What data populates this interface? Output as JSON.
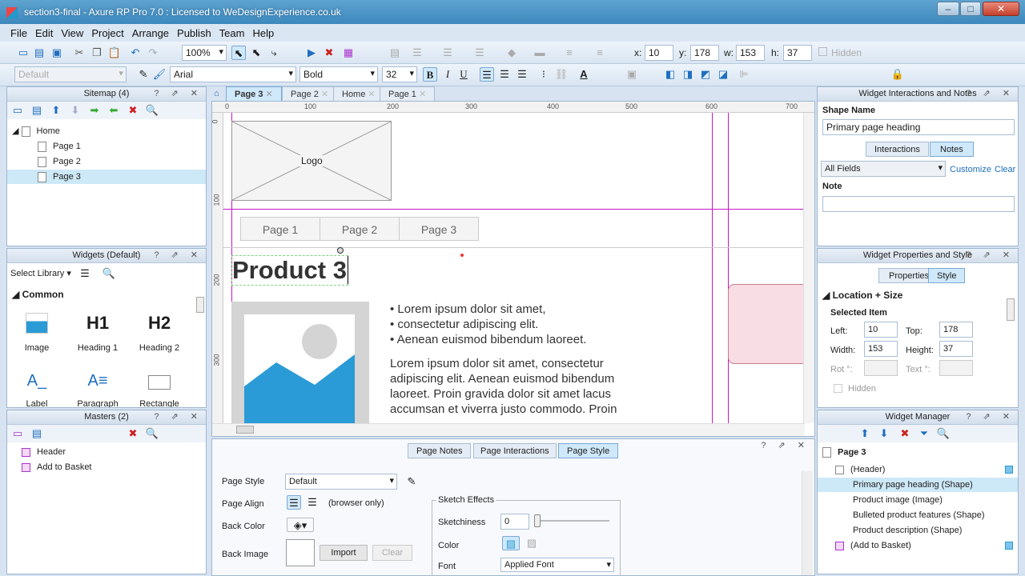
{
  "window": {
    "title": "section3-final - Axure RP Pro 7.0 : Licensed to WeDesignExperience.co.uk"
  },
  "menu": [
    "File",
    "Edit",
    "View",
    "Project",
    "Arrange",
    "Publish",
    "Team",
    "Help"
  ],
  "toolbar": {
    "zoom": "100%",
    "x_label": "x:",
    "x": "10",
    "y_label": "y:",
    "y": "178",
    "w_label": "w:",
    "w": "153",
    "h_label": "h:",
    "h": "37",
    "hidden": "Hidden"
  },
  "format": {
    "style": "Default",
    "font": "Arial",
    "weight": "Bold",
    "size": "32"
  },
  "sitemap": {
    "title": "Sitemap (4)",
    "items": [
      "Home",
      "Page 1",
      "Page 2",
      "Page 3"
    ]
  },
  "widgets": {
    "title": "Widgets (Default)",
    "select_library": "Select Library",
    "section": "Common",
    "items": [
      {
        "label": "Image",
        "glyph": ""
      },
      {
        "label": "Heading 1",
        "glyph": "H1"
      },
      {
        "label": "Heading 2",
        "glyph": "H2"
      },
      {
        "label": "Label",
        "glyph": "A_"
      },
      {
        "label": "Paragraph",
        "glyph": "A≡"
      },
      {
        "label": "Rectangle",
        "glyph": ""
      }
    ]
  },
  "masters": {
    "title": "Masters (2)",
    "items": [
      "Header",
      "Add to Basket"
    ]
  },
  "tabs": [
    "Page 3",
    "Page 2",
    "Home",
    "Page 1"
  ],
  "ruler": {
    "h": [
      "0",
      "100",
      "200",
      "300",
      "400",
      "500",
      "600",
      "700"
    ],
    "v": [
      "0",
      "100",
      "200",
      "300"
    ]
  },
  "canvas": {
    "logo": "Logo",
    "nav": [
      "Page 1",
      "Page 2",
      "Page 3"
    ],
    "heading": "Product 3",
    "bullets": [
      "• Lorem ipsum dolor sit amet,",
      "• consectetur adipiscing elit.",
      "• Aenean euismod bibendum laoreet."
    ],
    "para": [
      "Lorem ipsum dolor sit amet, consectetur",
      "adipiscing elit. Aenean euismod bibendum",
      "laoreet. Proin gravida dolor sit amet lacus",
      "accumsan et viverra justo commodo. Proin"
    ]
  },
  "pagepanel": {
    "tabs": [
      "Page Notes",
      "Page Interactions",
      "Page Style"
    ],
    "page_style_label": "Page Style",
    "page_style": "Default",
    "page_align_label": "Page Align",
    "browser_only": "(browser only)",
    "back_color": "Back Color",
    "back_image": "Back Image",
    "import": "Import",
    "clear": "Clear",
    "sketch_title": "Sketch Effects",
    "sketchiness": "Sketchiness",
    "sketch_value": "0",
    "color": "Color",
    "font": "Font",
    "font_value": "Applied Font"
  },
  "interactions": {
    "title": "Widget Interactions and Notes",
    "shape_name_label": "Shape Name",
    "shape_name": "Primary page heading",
    "tabs": [
      "Interactions",
      "Notes"
    ],
    "fields": "All Fields",
    "customize": "Customize",
    "clear": "Clear All",
    "note": "Note"
  },
  "properties": {
    "title": "Widget Properties and Style",
    "tabs": [
      "Properties",
      "Style"
    ],
    "section": "Location + Size",
    "selected": "Selected Item",
    "left_label": "Left:",
    "left": "10",
    "top_label": "Top:",
    "top": "178",
    "width_label": "Width:",
    "width": "153",
    "height_label": "Height:",
    "height": "37",
    "rot": "Rot °:",
    "text": "Text °:",
    "hidden": "Hidden"
  },
  "manager": {
    "title": "Widget Manager",
    "page": "Page 3",
    "items": [
      "(Header)",
      "Primary page heading (Shape)",
      "Product image (Image)",
      "Bulleted product features (Shape)",
      "Product description (Shape)",
      "(Add to Basket)"
    ]
  }
}
